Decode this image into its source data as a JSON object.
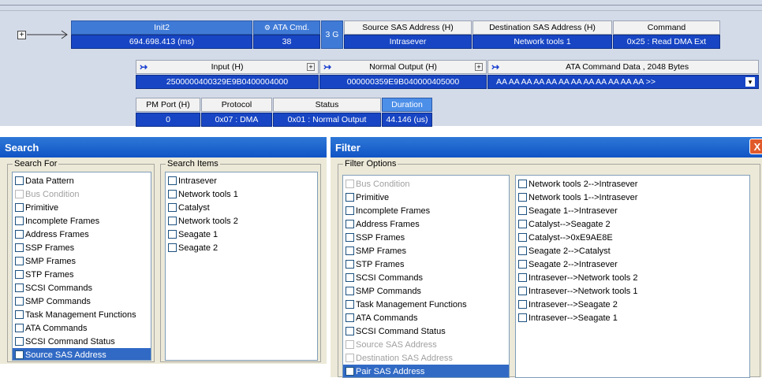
{
  "trace": {
    "expander": "+",
    "init_label": "Init2",
    "time_value": "694.698.413 (ms)",
    "ata_cmd_header": "ATA Cmd.",
    "ata_cmd_value": "38",
    "speed": "3 G",
    "source_header": "Source SAS Address (H)",
    "source_value": "Intrasever",
    "dest_header": "Destination SAS Address (H)",
    "dest_value": "Network tools 1",
    "command_header": "Command",
    "command_value": "0x25 : Read DMA Ext",
    "input_header": "Input (H)",
    "input_value": "2500000400329E9B0400004000",
    "normal_output_header": "Normal Output (H)",
    "normal_output_value": "000000359E9B040000405000",
    "ata_data_header": "ATA Command Data , 2048 Bytes",
    "ata_data_value": "AA AA AA AA AA AA AA AA AA AA AA AA  >>",
    "pm_port_header": "PM Port (H)",
    "pm_port_value": "0",
    "protocol_header": "Protocol",
    "protocol_value": "0x07 : DMA",
    "status_header": "Status",
    "status_value": "0x01 : Normal Output",
    "duration_header": "Duration",
    "duration_value": "44.146 (us)",
    "expand_symbol": "+",
    "arrow_symbol": "↣",
    "dropdown_symbol": "▾"
  },
  "search": {
    "title": "Search",
    "search_for_label": "Search For",
    "search_items_label": "Search Items",
    "search_for": [
      {
        "label": "Data Pattern",
        "disabled": false,
        "selected": false
      },
      {
        "label": "Bus Condition",
        "disabled": true,
        "selected": false
      },
      {
        "label": "Primitive",
        "disabled": false,
        "selected": false
      },
      {
        "label": "Incomplete Frames",
        "disabled": false,
        "selected": false
      },
      {
        "label": "Address Frames",
        "disabled": false,
        "selected": false
      },
      {
        "label": "SSP Frames",
        "disabled": false,
        "selected": false
      },
      {
        "label": "SMP Frames",
        "disabled": false,
        "selected": false
      },
      {
        "label": "STP Frames",
        "disabled": false,
        "selected": false
      },
      {
        "label": "SCSI Commands",
        "disabled": false,
        "selected": false
      },
      {
        "label": "SMP Commands",
        "disabled": false,
        "selected": false
      },
      {
        "label": "Task Management Functions",
        "disabled": false,
        "selected": false
      },
      {
        "label": "ATA Commands",
        "disabled": false,
        "selected": false
      },
      {
        "label": "SCSI Command Status",
        "disabled": false,
        "selected": false
      },
      {
        "label": "Source SAS Address",
        "disabled": false,
        "selected": true
      }
    ],
    "search_items": [
      "Intrasever",
      "Network tools 1",
      "Catalyst",
      "Network tools 2",
      "Seagate 1",
      "Seagate 2"
    ]
  },
  "filter": {
    "title": "Filter",
    "close_symbol": "X",
    "options_label": "Filter Options",
    "options": [
      {
        "label": "Bus Condition",
        "disabled": true,
        "selected": false
      },
      {
        "label": "Primitive",
        "disabled": false,
        "selected": false
      },
      {
        "label": "Incomplete Frames",
        "disabled": false,
        "selected": false
      },
      {
        "label": "Address Frames",
        "disabled": false,
        "selected": false
      },
      {
        "label": "SSP Frames",
        "disabled": false,
        "selected": false
      },
      {
        "label": "SMP Frames",
        "disabled": false,
        "selected": false
      },
      {
        "label": "STP Frames",
        "disabled": false,
        "selected": false
      },
      {
        "label": "SCSI Commands",
        "disabled": false,
        "selected": false
      },
      {
        "label": "SMP Commands",
        "disabled": false,
        "selected": false
      },
      {
        "label": "Task Management Functions",
        "disabled": false,
        "selected": false
      },
      {
        "label": "ATA Commands",
        "disabled": false,
        "selected": false
      },
      {
        "label": "SCSI Command Status",
        "disabled": false,
        "selected": false
      },
      {
        "label": "Source SAS Address",
        "disabled": true,
        "selected": false
      },
      {
        "label": "Destination SAS Address",
        "disabled": true,
        "selected": false
      },
      {
        "label": "Pair SAS Address",
        "disabled": false,
        "selected": true
      }
    ],
    "pairs": [
      "Network tools 2-->Intrasever",
      "Network tools 1-->Intrasever",
      "Seagate 1-->Intrasever",
      "Catalyst-->Seagate 2",
      "Catalyst-->0xE9AE8E",
      "Seagate 2-->Catalyst",
      "Seagate 2-->Intrasever",
      "Intrasever-->Network tools 2",
      "Intrasever-->Network tools 1",
      "Intrasever-->Seagate 2",
      "Intrasever-->Seagate 1"
    ]
  }
}
